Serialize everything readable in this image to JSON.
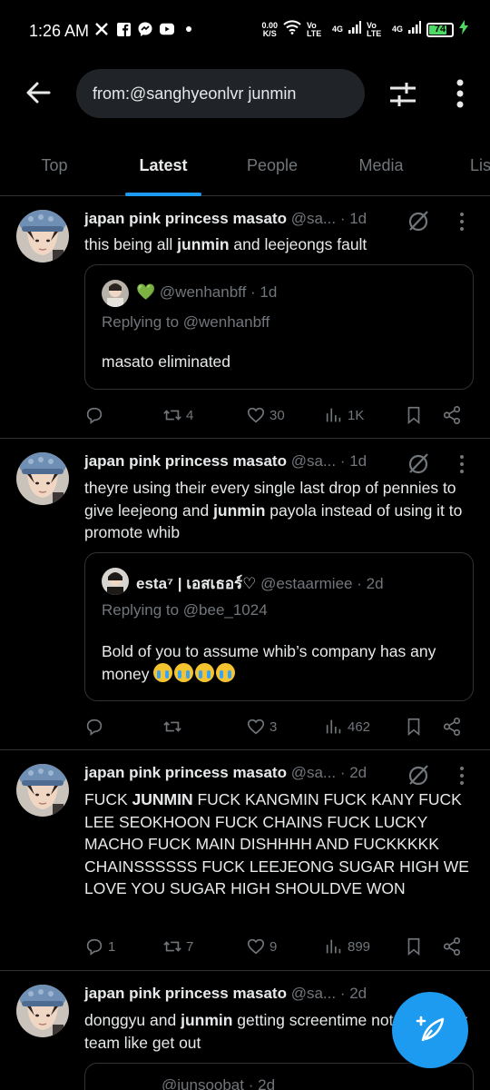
{
  "status_bar": {
    "time": "1:26 AM",
    "icons": [
      "x-logo-icon",
      "facebook-icon",
      "messenger-icon",
      "youtube-icon",
      "dot-icon"
    ],
    "net_speed": "0.00",
    "net_unit": "K/S",
    "sim1": "Vo LTE",
    "sim1_net": "4G",
    "sim2": "Vo LTE",
    "sim2_net": "4G",
    "battery": "74",
    "battery_level": 0.74,
    "charging": true
  },
  "header": {
    "search_query": "from:@sanghyeonlvr junmin"
  },
  "tabs": [
    {
      "label": "Top",
      "active": false
    },
    {
      "label": "Latest",
      "active": true
    },
    {
      "label": "People",
      "active": false
    },
    {
      "label": "Media",
      "active": false
    },
    {
      "label": "Lis",
      "active": false
    }
  ],
  "tweets": [
    {
      "name": "japan pink princess masato",
      "handle": "@sa...",
      "time": "· 1d",
      "body": [
        "this being all ",
        {
          "b": "junmin"
        },
        " and leejeongs fault"
      ],
      "quote": {
        "emoji_heart": "💚",
        "name": "",
        "handle": "@wenhanbff",
        "time": "· 1d",
        "reply": "Replying to @wenhanbff",
        "text": "masato eliminated"
      },
      "stats": {
        "replies": "",
        "retweets": "4",
        "likes": "30",
        "views": "1K"
      }
    },
    {
      "name": "japan pink princess masato",
      "handle": "@sa...",
      "time": "· 1d",
      "body": [
        "theyre using their every single last drop of pennies to give leejeong and ",
        {
          "b": "junmin"
        },
        " payola instead of using it to promote whib"
      ],
      "quote": {
        "name": "esta⁷ | เอสเธอร์♡",
        "handle": "@estaarmiee",
        "time": "· 2d",
        "reply": "Replying to @bee_1024",
        "text": "Bold of you to assume whib’s company has any money",
        "emoji_count": 4
      },
      "stats": {
        "replies": "",
        "retweets": "",
        "likes": "3",
        "views": "462"
      }
    },
    {
      "name": "japan pink princess masato",
      "handle": "@sa...",
      "time": "· 2d",
      "body": [
        "FUCK ",
        {
          "b": "JUNMIN"
        },
        " FUCK KANGMIN FUCK KANY FUCK LEE SEOKHOON FUCK CHAINS FUCK LUCKY MACHO FUCK MAIN DISHHHH AND FUCKKKKK CHAINSSSSSS FUCK LEEJEONG SUGAR HIGH WE LOVE YOU SUGAR HIGH SHOULDVE WON"
      ],
      "stats": {
        "replies": "1",
        "retweets": "7",
        "likes": "9",
        "views": "899"
      }
    },
    {
      "name": "japan pink princess masato",
      "handle": "@sa...",
      "time": "· 2d",
      "body": [
        "donggyu and ",
        {
          "b": "junmin"
        },
        " getting screentime not even their team like get out"
      ],
      "quote_partial": {
        "handle": "@junsoobat",
        "time": "· 2d"
      }
    }
  ]
}
